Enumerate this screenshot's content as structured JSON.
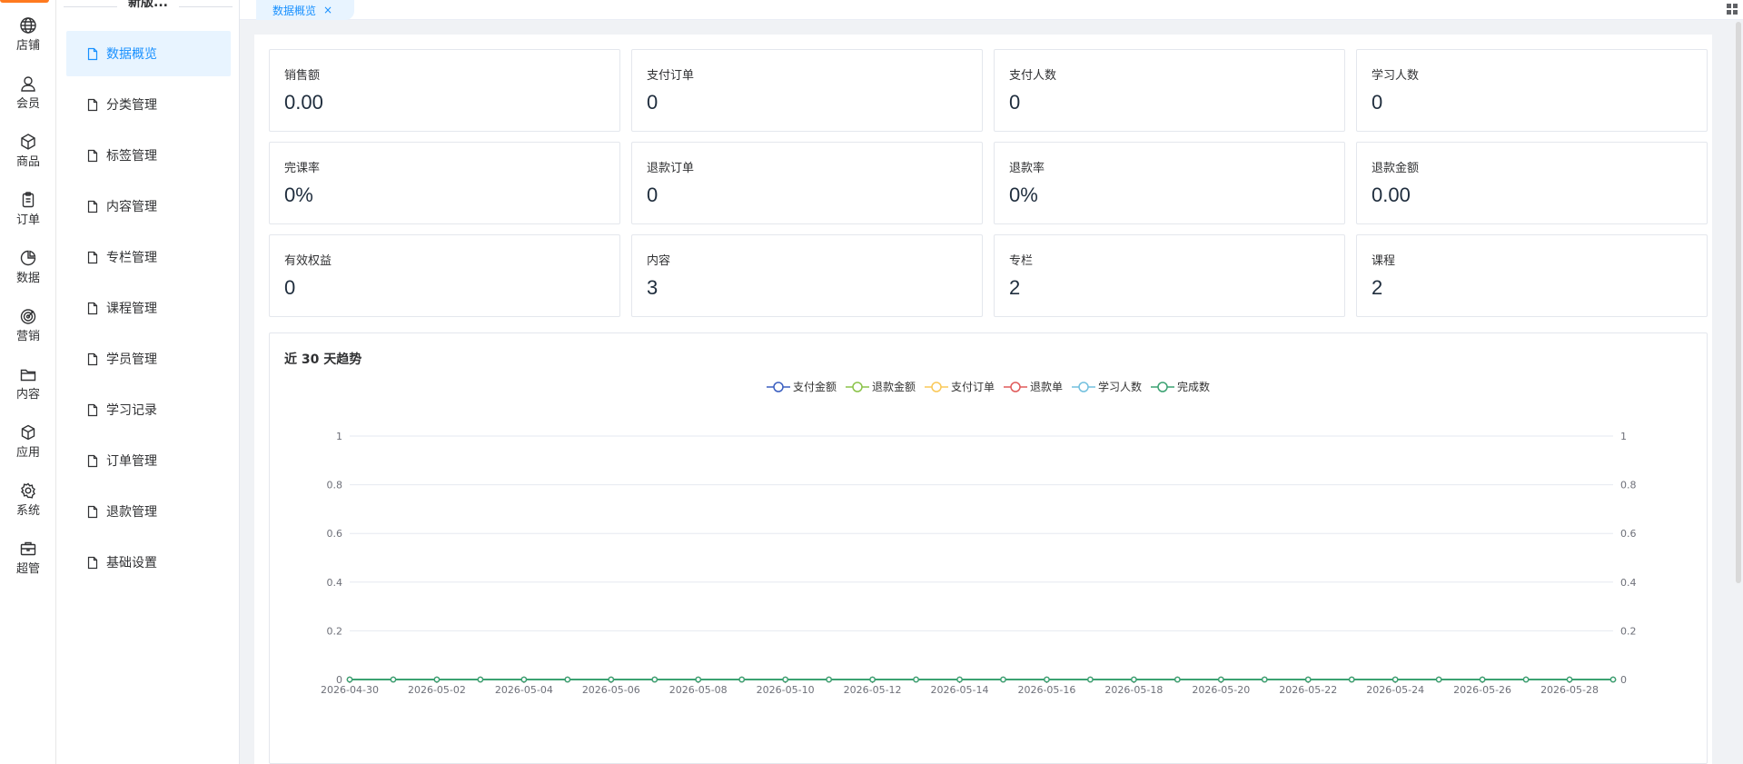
{
  "rail": {
    "items": [
      {
        "label": "店铺",
        "icon": "globe-icon"
      },
      {
        "label": "会员",
        "icon": "user-icon"
      },
      {
        "label": "商品",
        "icon": "package-icon"
      },
      {
        "label": "订单",
        "icon": "clipboard-icon"
      },
      {
        "label": "数据",
        "icon": "pie-chart-icon"
      },
      {
        "label": "营销",
        "icon": "target-icon"
      },
      {
        "label": "内容",
        "icon": "folder-icon"
      },
      {
        "label": "应用",
        "icon": "cube-icon"
      },
      {
        "label": "系统",
        "icon": "gear-icon"
      },
      {
        "label": "超管",
        "icon": "briefcase-icon"
      }
    ]
  },
  "submenu": {
    "title": "新版...",
    "items": [
      {
        "label": "数据概览",
        "active": true
      },
      {
        "label": "分类管理"
      },
      {
        "label": "标签管理"
      },
      {
        "label": "内容管理"
      },
      {
        "label": "专栏管理"
      },
      {
        "label": "课程管理"
      },
      {
        "label": "学员管理"
      },
      {
        "label": "学习记录"
      },
      {
        "label": "订单管理"
      },
      {
        "label": "退款管理"
      },
      {
        "label": "基础设置"
      }
    ]
  },
  "tabs": [
    {
      "label": "数据概览",
      "close": "×"
    }
  ],
  "stats": [
    {
      "label": "销售额",
      "value": "0.00"
    },
    {
      "label": "支付订单",
      "value": "0"
    },
    {
      "label": "支付人数",
      "value": "0"
    },
    {
      "label": "学习人数",
      "value": "0"
    },
    {
      "label": "完课率",
      "value": "0%"
    },
    {
      "label": "退款订单",
      "value": "0"
    },
    {
      "label": "退款率",
      "value": "0%"
    },
    {
      "label": "退款金额",
      "value": "0.00"
    },
    {
      "label": "有效权益",
      "value": "0"
    },
    {
      "label": "内容",
      "value": "3"
    },
    {
      "label": "专栏",
      "value": "2"
    },
    {
      "label": "课程",
      "value": "2"
    }
  ],
  "chart_data": {
    "type": "line",
    "title": "近 30 天趋势",
    "x": [
      "2026-04-30",
      "2026-05-01",
      "2026-05-02",
      "2026-05-03",
      "2026-05-04",
      "2026-05-05",
      "2026-05-06",
      "2026-05-07",
      "2026-05-08",
      "2026-05-09",
      "2026-05-10",
      "2026-05-11",
      "2026-05-12",
      "2026-05-13",
      "2026-05-14",
      "2026-05-15",
      "2026-05-16",
      "2026-05-17",
      "2026-05-18",
      "2026-05-19",
      "2026-05-20",
      "2026-05-21",
      "2026-05-22",
      "2026-05-23",
      "2026-05-24",
      "2026-05-25",
      "2026-05-26",
      "2026-05-27",
      "2026-05-28",
      "2026-05-29"
    ],
    "x_tick_labels": [
      "2026-04-30",
      "2026-05-02",
      "2026-05-04",
      "2026-05-06",
      "2026-05-08",
      "2026-05-10",
      "2026-05-12",
      "2026-05-14",
      "2026-05-16",
      "2026-05-18",
      "2026-05-20",
      "2026-05-22",
      "2026-05-24",
      "2026-05-26",
      "2026-05-28"
    ],
    "y_ticks": [
      "0",
      "0.2",
      "0.4",
      "0.6",
      "0.8",
      "1"
    ],
    "y_right_ticks": [
      "0",
      "0.2",
      "0.4",
      "0.6",
      "0.8",
      "1"
    ],
    "ylim": [
      0,
      1
    ],
    "y_right_lim": [
      0,
      1
    ],
    "grid": true,
    "legend_position": "top-center",
    "series": [
      {
        "name": "支付金额",
        "color": "#3b5fc0",
        "values": [
          0,
          0,
          0,
          0,
          0,
          0,
          0,
          0,
          0,
          0,
          0,
          0,
          0,
          0,
          0,
          0,
          0,
          0,
          0,
          0,
          0,
          0,
          0,
          0,
          0,
          0,
          0,
          0,
          0,
          0
        ]
      },
      {
        "name": "退款金额",
        "color": "#8bc34a",
        "values": [
          0,
          0,
          0,
          0,
          0,
          0,
          0,
          0,
          0,
          0,
          0,
          0,
          0,
          0,
          0,
          0,
          0,
          0,
          0,
          0,
          0,
          0,
          0,
          0,
          0,
          0,
          0,
          0,
          0,
          0
        ]
      },
      {
        "name": "支付订单",
        "color": "#fac858",
        "values": [
          0,
          0,
          0,
          0,
          0,
          0,
          0,
          0,
          0,
          0,
          0,
          0,
          0,
          0,
          0,
          0,
          0,
          0,
          0,
          0,
          0,
          0,
          0,
          0,
          0,
          0,
          0,
          0,
          0,
          0
        ]
      },
      {
        "name": "退款单",
        "color": "#e05a5a",
        "values": [
          0,
          0,
          0,
          0,
          0,
          0,
          0,
          0,
          0,
          0,
          0,
          0,
          0,
          0,
          0,
          0,
          0,
          0,
          0,
          0,
          0,
          0,
          0,
          0,
          0,
          0,
          0,
          0,
          0,
          0
        ]
      },
      {
        "name": "学习人数",
        "color": "#73c0de",
        "values": [
          0,
          0,
          0,
          0,
          0,
          0,
          0,
          0,
          0,
          0,
          0,
          0,
          0,
          0,
          0,
          0,
          0,
          0,
          0,
          0,
          0,
          0,
          0,
          0,
          0,
          0,
          0,
          0,
          0,
          0
        ]
      },
      {
        "name": "完成数",
        "color": "#3ba272",
        "values": [
          0,
          0,
          0,
          0,
          0,
          0,
          0,
          0,
          0,
          0,
          0,
          0,
          0,
          0,
          0,
          0,
          0,
          0,
          0,
          0,
          0,
          0,
          0,
          0,
          0,
          0,
          0,
          0,
          0,
          0
        ]
      }
    ]
  },
  "colors": {
    "accent": "#1890ff",
    "brand": "#ff7a1f",
    "active_bg": "#e8f4ff"
  }
}
